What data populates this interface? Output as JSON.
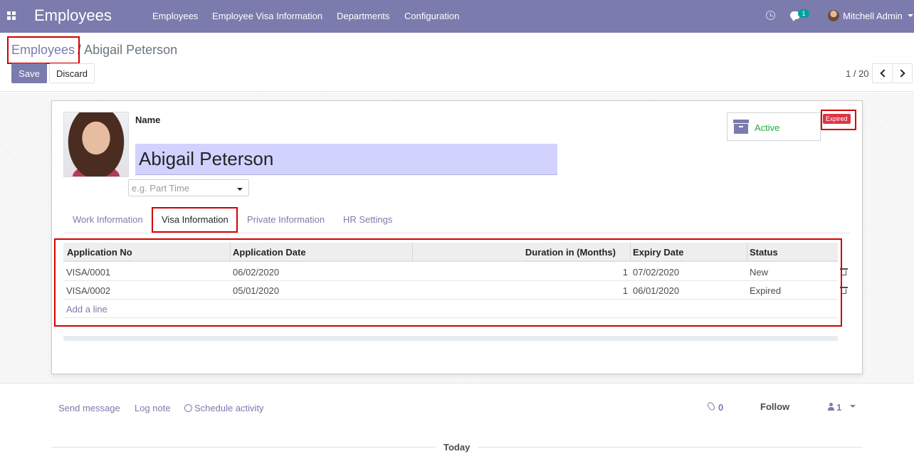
{
  "navbar": {
    "app_title": "Employees",
    "menu": [
      "Employees",
      "Employee Visa Information",
      "Departments",
      "Configuration"
    ],
    "chat_badge": "1",
    "user_name": "Mitchell Admin"
  },
  "control_panel": {
    "breadcrumb_parent": "Employees",
    "breadcrumb_separator": "/",
    "breadcrumb_current": "Abigail Peterson",
    "save_label": "Save",
    "discard_label": "Discard",
    "pager": "1 / 20"
  },
  "form": {
    "name_label": "Name",
    "name_value": "Abigail Peterson",
    "job_placeholder": "e.g. Part Time",
    "active_label": "Active",
    "ribbon_label": "Expired",
    "tabs": [
      "Work Information",
      "Visa Information",
      "Private Information",
      "HR Settings"
    ],
    "active_tab": "Visa Information"
  },
  "visa_table": {
    "columns": [
      "Application No",
      "Application Date",
      "Duration in (Months)",
      "Expiry Date",
      "Status"
    ],
    "rows": [
      {
        "application_no": "VISA/0001",
        "application_date": "06/02/2020",
        "duration": "1",
        "expiry_date": "07/02/2020",
        "status": "New"
      },
      {
        "application_no": "VISA/0002",
        "application_date": "05/01/2020",
        "duration": "1",
        "expiry_date": "06/01/2020",
        "status": "Expired"
      }
    ],
    "add_line_label": "Add a line"
  },
  "chatter": {
    "send_message": "Send message",
    "log_note": "Log note",
    "schedule_activity": "Schedule activity",
    "attachments_count": "0",
    "follow_label": "Follow",
    "followers_count": "1",
    "today_label": "Today"
  },
  "colors": {
    "brand": "#7c7bad",
    "active_green": "#28a745",
    "expired_red": "#dc3545",
    "highlight_red": "#d20000"
  }
}
